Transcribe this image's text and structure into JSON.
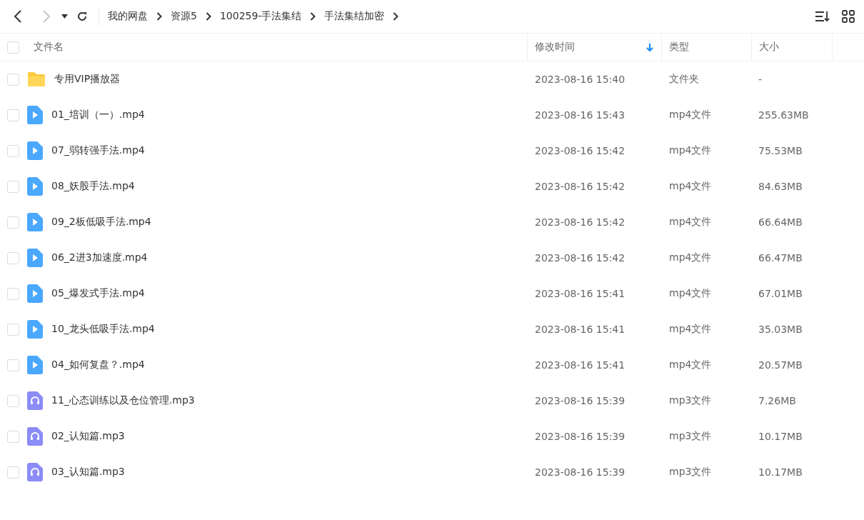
{
  "toolbar": {
    "back": {
      "disabled": false
    },
    "forward": {
      "disabled": true
    }
  },
  "breadcrumbs": [
    "我的网盘",
    "资源5",
    "100259-手法集结",
    "手法集结加密"
  ],
  "table": {
    "select_all": {
      "checked": false
    },
    "columns": [
      {
        "label": "文件名",
        "sorted": false
      },
      {
        "label": "修改时间",
        "sorted": true
      },
      {
        "label": "类型",
        "sorted": false
      },
      {
        "label": "大小",
        "sorted": false
      }
    ],
    "rows": [
      {
        "kind": "folder",
        "name": "专用VIP播放器",
        "modified": "2023-08-16 15:40",
        "type": "文件夹",
        "size": "-",
        "checked": false
      },
      {
        "kind": "video",
        "name": "01_培训（一）.mp4",
        "modified": "2023-08-16 15:43",
        "type": "mp4文件",
        "size": "255.63MB",
        "checked": false
      },
      {
        "kind": "video",
        "name": "07_弱转强手法.mp4",
        "modified": "2023-08-16 15:42",
        "type": "mp4文件",
        "size": "75.53MB",
        "checked": false
      },
      {
        "kind": "video",
        "name": "08_妖股手法.mp4",
        "modified": "2023-08-16 15:42",
        "type": "mp4文件",
        "size": "84.63MB",
        "checked": false
      },
      {
        "kind": "video",
        "name": "09_2板低吸手法.mp4",
        "modified": "2023-08-16 15:42",
        "type": "mp4文件",
        "size": "66.64MB",
        "checked": false
      },
      {
        "kind": "video",
        "name": "06_2进3加速度.mp4",
        "modified": "2023-08-16 15:42",
        "type": "mp4文件",
        "size": "66.47MB",
        "checked": false
      },
      {
        "kind": "video",
        "name": "05_爆发式手法.mp4",
        "modified": "2023-08-16 15:41",
        "type": "mp4文件",
        "size": "67.01MB",
        "checked": false
      },
      {
        "kind": "video",
        "name": "10_龙头低吸手法.mp4",
        "modified": "2023-08-16 15:41",
        "type": "mp4文件",
        "size": "35.03MB",
        "checked": false
      },
      {
        "kind": "video",
        "name": "04_如何复盘？.mp4",
        "modified": "2023-08-16 15:41",
        "type": "mp4文件",
        "size": "20.57MB",
        "checked": false
      },
      {
        "kind": "audio",
        "name": "11_心态训练以及仓位管理.mp3",
        "modified": "2023-08-16 15:39",
        "type": "mp3文件",
        "size": "7.26MB",
        "checked": false
      },
      {
        "kind": "audio",
        "name": "02_认知篇.mp3",
        "modified": "2023-08-16 15:39",
        "type": "mp3文件",
        "size": "10.17MB",
        "checked": false
      },
      {
        "kind": "audio",
        "name": "03_认知篇.mp3",
        "modified": "2023-08-16 15:39",
        "type": "mp3文件",
        "size": "10.17MB",
        "checked": false
      }
    ]
  }
}
